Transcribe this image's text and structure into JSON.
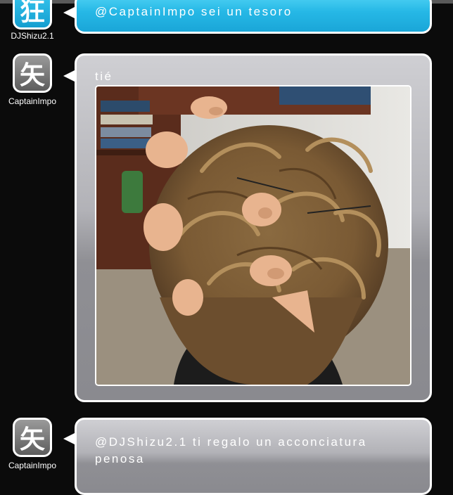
{
  "messages": [
    {
      "username": "DJShizu2.1",
      "avatar_glyph": "狂",
      "text": "@CaptainImpo sei un tesoro",
      "style": "blue"
    },
    {
      "username": "CaptainImpo",
      "avatar_glyph": "矢",
      "text": "tié",
      "style": "gray",
      "attachment": "photo"
    },
    {
      "username": "CaptainImpo",
      "avatar_glyph": "矢",
      "text_line1": "@DJShizu2.1 ti regalo un acconciatura",
      "text_line2": "penosa",
      "style": "gray"
    }
  ],
  "colors": {
    "bubble_blue": "#26b8e6",
    "bubble_gray": "#b2b2b7",
    "background": "#0b0b0b"
  }
}
